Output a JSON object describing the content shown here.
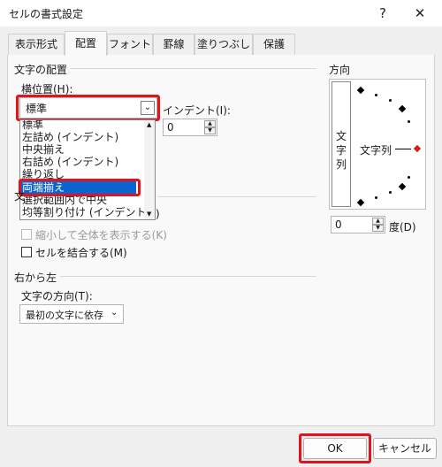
{
  "window": {
    "title": "セルの書式設定",
    "help_label": "?",
    "close_label": "✕"
  },
  "tabs": [
    {
      "label": "表示形式"
    },
    {
      "label": "配置"
    },
    {
      "label": "フォント"
    },
    {
      "label": "罫線"
    },
    {
      "label": "塗りつぶし"
    },
    {
      "label": "保護"
    }
  ],
  "text_alignment": {
    "group_label": "文字の配置",
    "horizontal_label": "横位置(H):",
    "horizontal_value": "標準",
    "indent_label": "インデント(I):",
    "indent_value": "0",
    "options": [
      "標準",
      "左詰め (インデント)",
      "中央揃え",
      "右詰め (インデント)",
      "繰り返し",
      "両端揃え",
      "選択範囲内で中央",
      "均等割り付け (インデント)"
    ],
    "selected_option": "両端揃え"
  },
  "text_control": {
    "group_label_partial": "文",
    "hidden_suffix": ")",
    "shrink_to_fit_label": "縮小して全体を表示する(K)",
    "merge_cells_label": "セルを結合する(M)"
  },
  "rtl": {
    "group_label": "右から左",
    "direction_label": "文字の方向(T):",
    "direction_value": "最初の文字に依存"
  },
  "orientation": {
    "group_label": "方向",
    "vertical_chars": [
      "文",
      "字",
      "列"
    ],
    "horizontal_text": "文字列",
    "degree_value": "0",
    "degree_label": "度(D)"
  },
  "footer": {
    "ok_label": "OK",
    "cancel_label": "キャンセル"
  },
  "colors": {
    "highlight_red": "#e0141e",
    "selection_blue": "#0a64d2"
  }
}
